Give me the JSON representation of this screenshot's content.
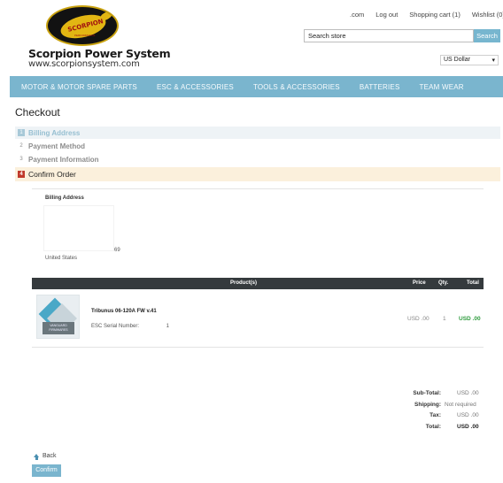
{
  "header": {
    "brand_name": "Scorpion Power System",
    "brand_url": "www.scorpionsystem.com",
    "logo_text": "SCORPION",
    "logo_subtext": "PERFORMANCE",
    "top_links": [
      ".com",
      "Log out",
      "Shopping cart (1)",
      "Wishlist (0)"
    ],
    "search_value": "Search store",
    "search_button": "Search",
    "currency": "US Dollar",
    "currency_arrow": "▾"
  },
  "nav": {
    "items": [
      "MOTOR & MOTOR SPARE PARTS",
      "ESC & ACCESSORIES",
      "TOOLS & ACCESSORIES",
      "BATTERIES",
      "TEAM WEAR"
    ]
  },
  "page_title": "Checkout",
  "steps": [
    {
      "num": "1",
      "label": "Billing Address"
    },
    {
      "num": "2",
      "label": "Payment Method"
    },
    {
      "num": "3",
      "label": "Payment Information"
    },
    {
      "num": "4",
      "label": "Confirm Order"
    }
  ],
  "billing": {
    "label": "Billing Address",
    "zip_fragment": "69",
    "country": "United States"
  },
  "table": {
    "headers": {
      "product": "Product(s)",
      "price": "Price",
      "qty": "Qty.",
      "total": "Total"
    },
    "rows": [
      {
        "name": "Tribunus 06-120A FW v.41",
        "serial_label": "ESC Serial Number:",
        "serial_value": "1",
        "price": "USD .00",
        "qty": "1",
        "total": "USD .00",
        "image_caption": "VANGUARD FIRMWARES"
      }
    ]
  },
  "totals": {
    "subtotal_label": "Sub-Total:",
    "subtotal_value": "USD .00",
    "shipping_label": "Shipping:",
    "shipping_value": "Not required",
    "tax_label": "Tax:",
    "tax_value": "USD .00",
    "total_label": "Total:",
    "total_value": "USD .00"
  },
  "actions": {
    "back": "Back",
    "confirm": "Confirm"
  },
  "colors": {
    "nav_bg": "#7ab5ce",
    "confirm_step_bg": "#fbf0dc",
    "step_badge_active": "#c0392b",
    "total_green": "#2e9b3d"
  }
}
